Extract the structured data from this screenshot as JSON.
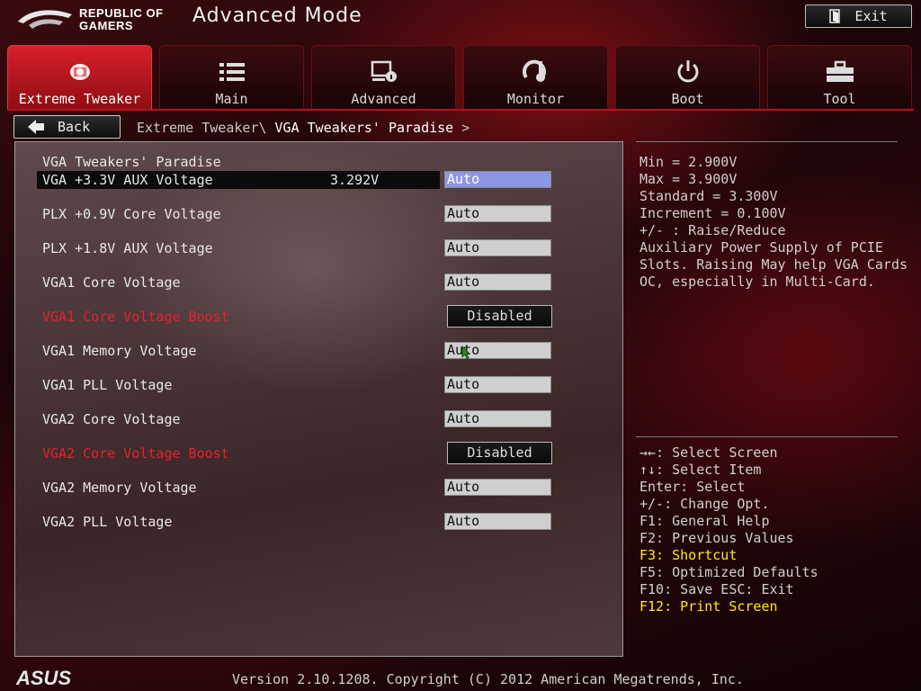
{
  "header": {
    "logo_text_line1": "REPUBLIC OF",
    "logo_text_line2": "GAMERS",
    "title": "Advanced Mode",
    "exit_label": "Exit"
  },
  "tabs": [
    {
      "label": "Extreme Tweaker",
      "icon": "tweaker-icon",
      "active": true
    },
    {
      "label": "Main",
      "icon": "list-icon"
    },
    {
      "label": "Advanced",
      "icon": "advanced-icon"
    },
    {
      "label": "Monitor",
      "icon": "monitor-icon"
    },
    {
      "label": "Boot",
      "icon": "power-icon"
    },
    {
      "label": "Tool",
      "icon": "toolbox-icon"
    }
  ],
  "nav": {
    "back_label": "Back",
    "breadcrumb_parent": "Extreme Tweaker\\ ",
    "breadcrumb_current": "VGA Tweakers' Paradise",
    "breadcrumb_arrow": ">"
  },
  "panel": {
    "heading": "VGA Tweakers' Paradise",
    "rows": [
      {
        "label": "VGA +3.3V AUX Voltage",
        "reading": "3.292V",
        "value": "Auto",
        "type": "field",
        "selected": true
      },
      {
        "label": "PLX +0.9V Core Voltage",
        "value": "Auto",
        "type": "field"
      },
      {
        "label": "PLX +1.8V AUX Voltage",
        "value": "Auto",
        "type": "field"
      },
      {
        "label": "VGA1 Core Voltage",
        "value": "Auto",
        "type": "field"
      },
      {
        "label": "VGA1 Core Voltage Boost",
        "value": "Disabled",
        "type": "toggle",
        "red": true
      },
      {
        "label": "VGA1 Memory Voltage",
        "value": "Auto",
        "type": "field"
      },
      {
        "label": "VGA1 PLL Voltage",
        "value": "Auto",
        "type": "field"
      },
      {
        "label": "VGA2 Core Voltage",
        "value": "Auto",
        "type": "field"
      },
      {
        "label": "VGA2 Core Voltage Boost",
        "value": "Disabled",
        "type": "toggle",
        "red": true
      },
      {
        "label": "VGA2 Memory Voltage",
        "value": "Auto",
        "type": "field"
      },
      {
        "label": "VGA2 PLL Voltage",
        "value": "Auto",
        "type": "field"
      }
    ]
  },
  "help": {
    "lines": [
      "Min = 2.900V",
      "Max = 3.900V",
      "Standard = 3.300V",
      "Increment = 0.100V",
      "+/- : Raise/Reduce",
      "Auxiliary Power Supply of PCIE",
      "Slots. Raising May help VGA Cards",
      "OC, especially in Multi-Card."
    ]
  },
  "keys": [
    {
      "text": "→←: Select Screen"
    },
    {
      "text": "↑↓: Select Item"
    },
    {
      "text": "Enter: Select"
    },
    {
      "text": "+/-: Change Opt."
    },
    {
      "text": "F1: General Help"
    },
    {
      "text": "F2: Previous Values"
    },
    {
      "text": "F3: Shortcut",
      "highlight": true
    },
    {
      "text": "F5: Optimized Defaults"
    },
    {
      "text": "F10: Save  ESC: Exit"
    },
    {
      "text": "F12: Print Screen",
      "highlight": true
    }
  ],
  "footer": {
    "brand": "ASUS",
    "version": "Version 2.10.1208. Copyright (C) 2012 American Megatrends, Inc."
  },
  "colors": {
    "accent": "#d8202a",
    "warning_label": "#e3222a",
    "selected_field": "#8d95e5",
    "hotkey_highlight": "#ffe71a"
  }
}
